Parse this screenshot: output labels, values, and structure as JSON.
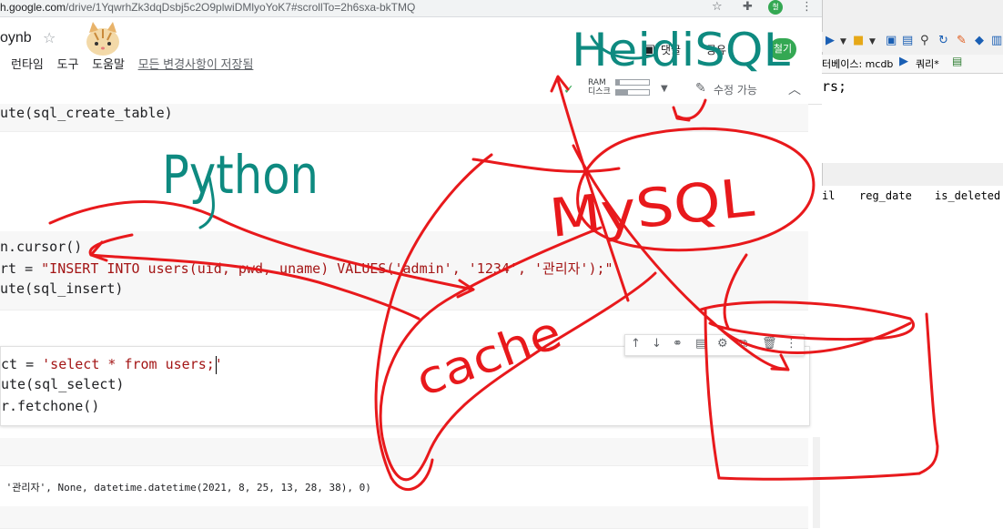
{
  "browser": {
    "url_host": "h.google.com",
    "url_path": "/drive/1YqwrhZk3dqDsbj5c2O9plwiDMlyoYoK7#scrollTo=2h6sxa-bkTMQ",
    "star_icon": "star-icon",
    "ext_icon": "puzzle-icon",
    "avatar_text": "철",
    "menu_icon": "more-vert-icon"
  },
  "notebook": {
    "title": "oynb",
    "star_icon": "star-outline-icon",
    "menu": [
      "런타임",
      "도구",
      "도움말"
    ],
    "saved_status": "모든 변경사항이 저장됨",
    "comment_label": "댓글",
    "share_label": "공유",
    "avatar_text": "철기",
    "ram_label": "RAM",
    "disk_label": "디스크",
    "ram_usage": 0.1,
    "disk_usage": 0.35,
    "edit_label": "수정 가능"
  },
  "cells": {
    "c1_line1": "ute(sql_create_table)",
    "c2_line1": "n.cursor()",
    "c2_line2_pre": "rt = ",
    "c2_line2_str": "\"INSERT INTO users(uid, pwd, uname) VALUES('admin', '1234', '관리자');\"",
    "c2_line3": "ute(sql_insert)",
    "c3_line1_pre": "ct = ",
    "c3_line1_str": "'select * from users;'",
    "c3_line2": "ute(sql_select)",
    "c3_line3": "r.fetchone()",
    "output": " '관리자', None, datetime.datetime(2021, 8, 25, 13, 28, 38), 0)"
  },
  "heidisql": {
    "db_tab": "터베이스: mcdb",
    "query_tab": "쿼리*",
    "editor_text": "rs;",
    "columns": [
      "il",
      "reg_date",
      "is_deleted"
    ]
  },
  "annotations": {
    "heidisql": "HeidiSQL",
    "python": "Python",
    "mysql": "MySQL",
    "cache": "cache",
    "ink_green": "#0e8a80",
    "ink_red": "#e8191c"
  }
}
